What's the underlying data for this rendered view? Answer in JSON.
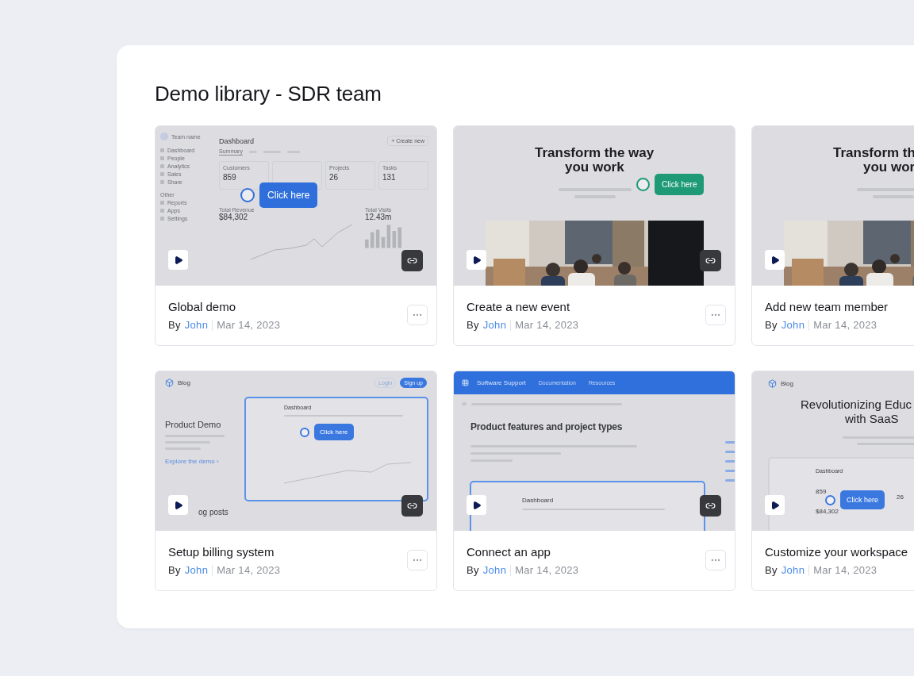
{
  "library": {
    "title": "Demo library - SDR team"
  },
  "cards": [
    {
      "title": "Global demo",
      "by_label": "By",
      "author": "John",
      "date": "Mar 14, 2023",
      "more_button": true,
      "link_button": true,
      "thumbnail": {
        "kind": "dashboard",
        "team": "Team name",
        "nav": [
          "Dashboard",
          "People",
          "Analytics",
          "Sales",
          "Share"
        ],
        "nav_section": "Other",
        "nav_more": [
          "Reports",
          "Apps",
          "Settings"
        ],
        "heading": "Dashboard",
        "action": "+ Create new",
        "tab": "Summary",
        "stats": [
          {
            "label": "Customers",
            "value": "859"
          },
          {
            "label": "Projects",
            "value": "26"
          },
          {
            "label": "Tasks",
            "value": "131"
          }
        ],
        "tooltip": "Click here",
        "revenue": {
          "label": "Total Revenue",
          "value": "$84,302"
        },
        "visits": {
          "label": "Total Visits",
          "value": "12.43m"
        }
      }
    },
    {
      "title": "Create a new event",
      "by_label": "By",
      "author": "John",
      "date": "Mar 14, 2023",
      "more_button": true,
      "link_button": true,
      "thumbnail": {
        "kind": "hero",
        "lines": [
          "Transform the way",
          "you work"
        ],
        "tooltip": "Click here"
      }
    },
    {
      "title": "Add new team member",
      "by_label": "By",
      "author": "John",
      "date": "Mar 14, 2023",
      "more_button": false,
      "link_button": false,
      "thumbnail": {
        "kind": "hero",
        "lines": [
          "Transform th",
          "you wor"
        ]
      }
    },
    {
      "title": "Setup billing system",
      "by_label": "By",
      "author": "John",
      "date": "Mar 14, 2023",
      "more_button": true,
      "link_button": true,
      "thumbnail": {
        "kind": "blog",
        "brand": "Blog",
        "login": "Login",
        "signup": "Sign up",
        "heading": "Product Demo",
        "link": "Explore the demo ›",
        "inner_heading": "Dashboard",
        "tooltip": "Click here",
        "footer": "og posts"
      }
    },
    {
      "title": "Connect an app",
      "by_label": "By",
      "author": "John",
      "date": "Mar 14, 2023",
      "more_button": true,
      "link_button": true,
      "thumbnail": {
        "kind": "support",
        "brand": "Software Support",
        "menus": [
          "Documentation",
          "Resources"
        ],
        "heading": "Product features and project types",
        "inner_heading": "Dashboard"
      }
    },
    {
      "title": "Customize your workspace",
      "by_label": "By",
      "author": "John",
      "date": "Mar 14, 2023",
      "more_button": false,
      "link_button": false,
      "thumbnail": {
        "kind": "edu",
        "brand": "Blog",
        "lines": [
          "Revolutionizing Educ",
          "with SaaS"
        ],
        "inner_heading": "Dashboard",
        "stat": "859",
        "tooltip": "Click here",
        "stat_2": "26",
        "revenue": "$84,302"
      }
    }
  ]
}
